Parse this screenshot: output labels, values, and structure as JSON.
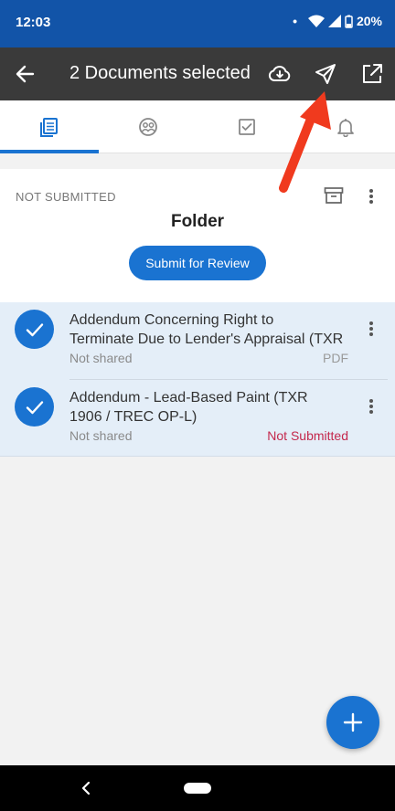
{
  "status_bar": {
    "time": "12:03",
    "battery": "20%",
    "dot": "•"
  },
  "app_bar": {
    "title": "2 Documents selected",
    "icons": [
      "back-arrow-icon",
      "cloud-download-icon",
      "send-icon",
      "open-external-icon"
    ]
  },
  "tabs": [
    {
      "icon": "documents-icon",
      "active": true
    },
    {
      "icon": "people-icon",
      "active": false
    },
    {
      "icon": "checkbox-icon",
      "active": false
    },
    {
      "icon": "bell-icon",
      "active": false
    }
  ],
  "folder": {
    "status": "NOT SUBMITTED",
    "title": "Folder",
    "submit_label": "Submit for Review"
  },
  "documents": [
    {
      "title_line1": "Addendum Concerning Right to",
      "title_line2": "Terminate Due to Lender's Appraisal (TXR",
      "shared": "Not shared",
      "meta": "PDF",
      "selected": true
    },
    {
      "title_line1": "Addendum - Lead-Based Paint (TXR",
      "title_line2": "1906 / TREC OP-L)",
      "shared": "Not shared",
      "meta": "Not Submitted",
      "selected": true
    }
  ],
  "colors": {
    "accent": "#1a73d1",
    "status_bar": "#1254a8",
    "app_bar": "#3a3a3a",
    "not_submitted": "#c4284d",
    "annotation_arrow": "#f03a1e"
  }
}
